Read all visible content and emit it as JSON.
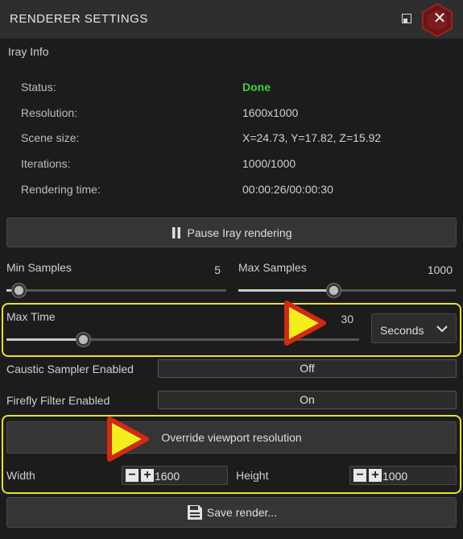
{
  "window": {
    "title": "RENDERER SETTINGS"
  },
  "iray_info": {
    "section_title": "Iray Info",
    "rows": [
      {
        "label": "Status:",
        "value": "Done"
      },
      {
        "label": "Resolution:",
        "value": "1600x1000"
      },
      {
        "label": "Scene size:",
        "value": "X=24.73, Y=17.82, Z=15.92"
      },
      {
        "label": "Iterations:",
        "value": "1000/1000"
      },
      {
        "label": "Rendering time:",
        "value": "00:00:26/00:00:30"
      }
    ]
  },
  "pause_button": {
    "label": "Pause Iray rendering"
  },
  "min_samples": {
    "label": "Min Samples",
    "value": "5",
    "fraction": 0.06
  },
  "max_samples": {
    "label": "Max Samples",
    "value": "1000",
    "fraction": 0.44
  },
  "max_time": {
    "label": "Max Time",
    "value": "30",
    "fraction": 0.22,
    "unit": "Seconds"
  },
  "caustic_sampler": {
    "label": "Caustic Sampler Enabled",
    "value": "Off"
  },
  "firefly_filter": {
    "label": "Firefly Filter Enabled",
    "value": "On"
  },
  "override_button": {
    "label": "Override viewport resolution"
  },
  "width": {
    "label": "Width",
    "value": "1600"
  },
  "height": {
    "label": "Height",
    "value": "1000"
  },
  "save_button": {
    "label": "Save render..."
  },
  "colors": {
    "status_done": "#3bd23b",
    "highlight": "#e4e41e",
    "arrow_fill": "#f2ef1a",
    "arrow_outline": "#d22a12",
    "badge": "#8a1e1e"
  }
}
